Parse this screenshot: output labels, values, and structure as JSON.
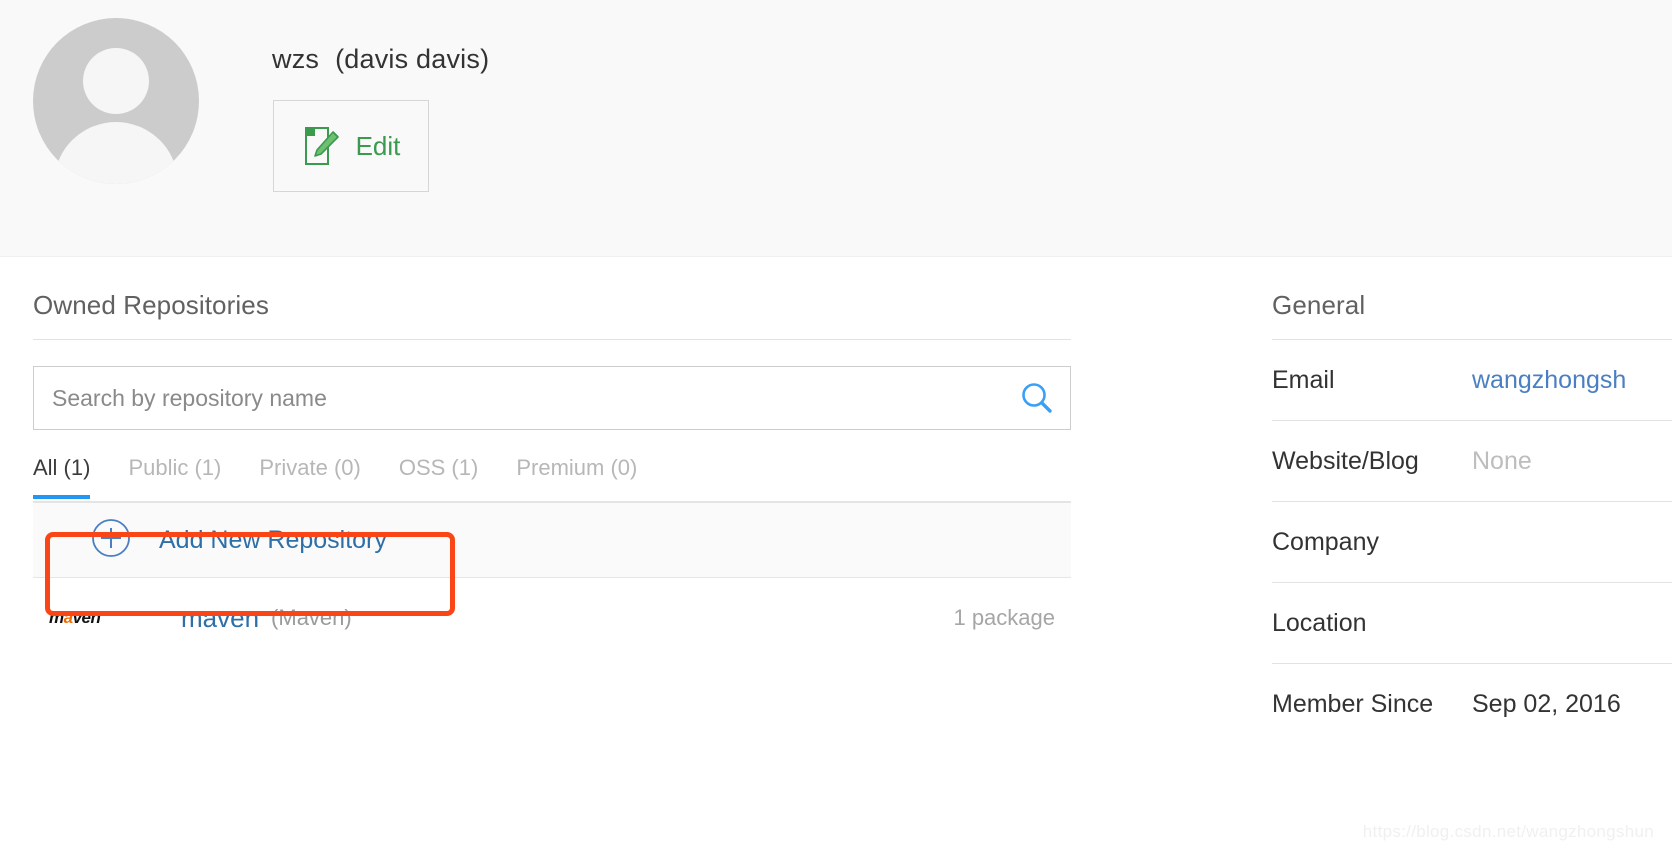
{
  "profile": {
    "username": "wzs",
    "full_name": "(davis davis)",
    "edit_label": "Edit",
    "edit_icon": "document-pencil-icon",
    "avatar_icon": "default-user-avatar"
  },
  "repositories": {
    "title": "Owned Repositories",
    "search": {
      "placeholder": "Search by repository name",
      "value": "",
      "icon": "search-icon"
    },
    "tabs": [
      {
        "label": "All (1)",
        "active": true
      },
      {
        "label": "Public (1)",
        "active": false
      },
      {
        "label": "Private (0)",
        "active": false
      },
      {
        "label": "OSS (1)",
        "active": false
      },
      {
        "label": "Premium (0)",
        "active": false
      }
    ],
    "add_new": {
      "label": "Add New Repository",
      "icon": "plus-circle-icon"
    },
    "rows": [
      {
        "logo_prefix": "m",
        "logo_accent": "a",
        "logo_suffix": "ven",
        "name": "maven",
        "type": "(Maven)",
        "packages": "1 package"
      }
    ]
  },
  "general": {
    "title": "General",
    "rows": [
      {
        "label": "Email",
        "value": "wangzhongsh",
        "style": "link"
      },
      {
        "label": "Website/Blog",
        "value": "None",
        "style": "muted"
      },
      {
        "label": "Company",
        "value": "",
        "style": "plain"
      },
      {
        "label": "Location",
        "value": "",
        "style": "plain"
      },
      {
        "label": "Member Since",
        "value": "Sep 02, 2016",
        "style": "plain"
      }
    ]
  },
  "watermark": "https://blog.csdn.net/wangzhongshun",
  "colors": {
    "accent_blue": "#2196f3",
    "link_blue": "#2f6fa8",
    "edit_green": "#3a9a4e",
    "annotation_red": "#fa4616",
    "maven_orange": "#ef6c00"
  }
}
